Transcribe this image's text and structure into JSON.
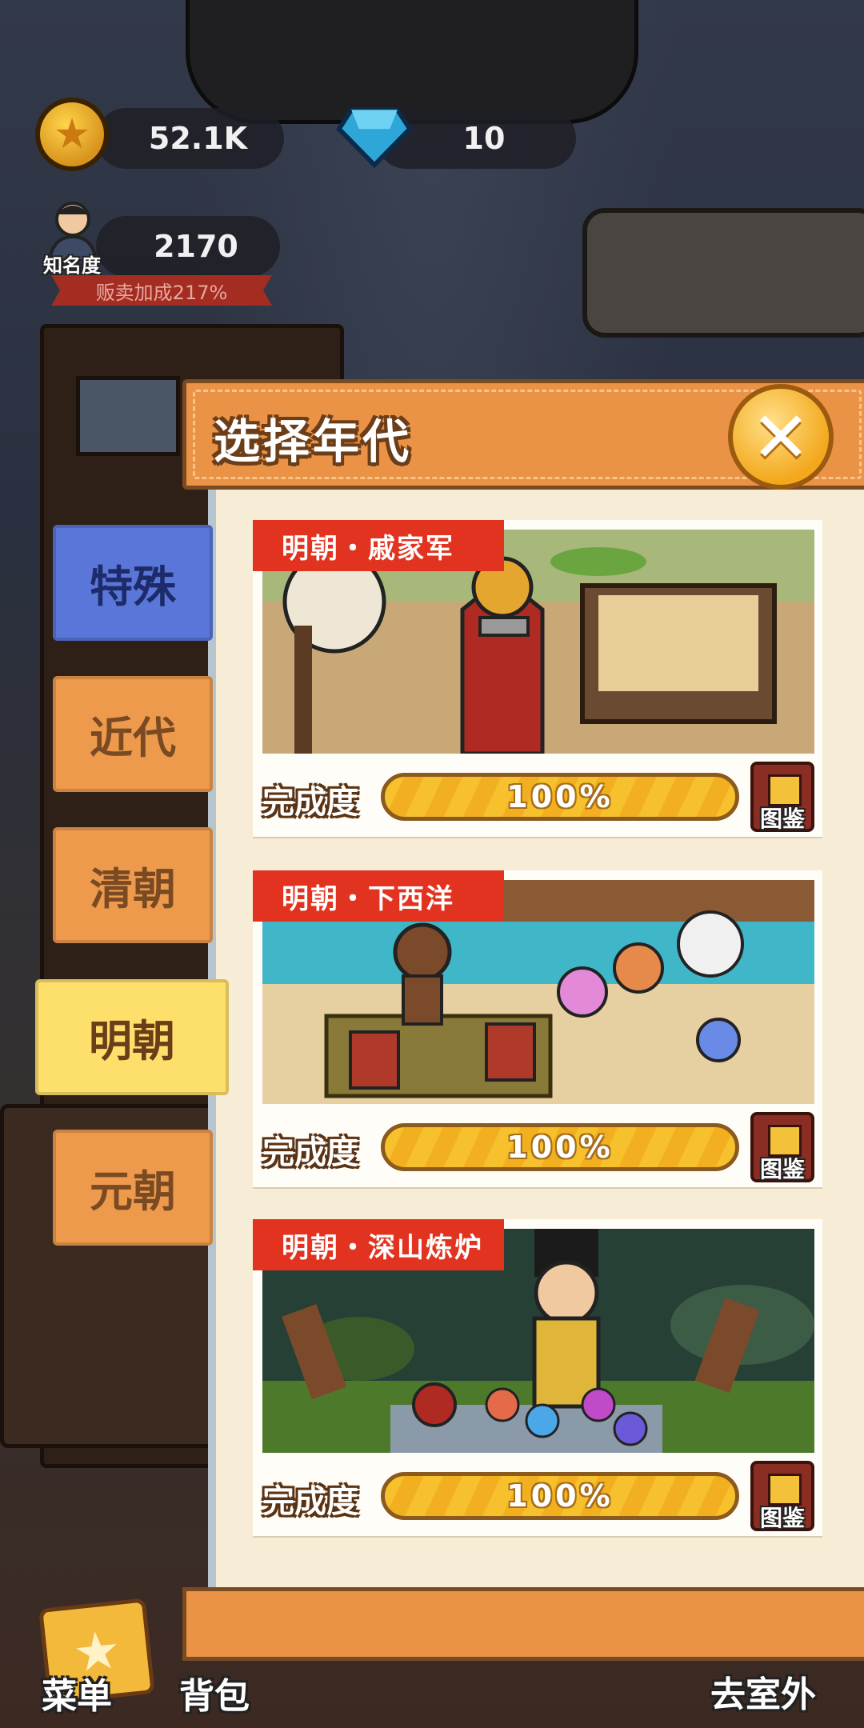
{
  "hud": {
    "coins": "52.1K",
    "gems": "10",
    "fame_value": "2170",
    "fame_label": "知名度",
    "bonus_text": "贩卖加成217%"
  },
  "panel": {
    "title": "选择年代"
  },
  "tabs": [
    {
      "label": "特殊",
      "state": "blue"
    },
    {
      "label": "近代",
      "state": "normal"
    },
    {
      "label": "清朝",
      "state": "normal"
    },
    {
      "label": "明朝",
      "state": "selected"
    },
    {
      "label": "元朝",
      "state": "normal"
    }
  ],
  "cards": [
    {
      "tag": "明朝・戚家军",
      "completion_label": "完成度",
      "progress": 1.0,
      "progress_text": "100%",
      "book_label": "图鉴"
    },
    {
      "tag": "明朝・下西洋",
      "completion_label": "完成度",
      "progress": 1.0,
      "progress_text": "100%",
      "book_label": "图鉴"
    },
    {
      "tag": "明朝・深山炼炉",
      "completion_label": "完成度",
      "progress": 1.0,
      "progress_text": "100%",
      "book_label": "图鉴"
    }
  ],
  "bottom_nav": {
    "menu": "菜单",
    "bag": "背包",
    "outside": "去室外"
  },
  "colors": {
    "accent_orange": "#ea9245",
    "tag_red": "#e1331f",
    "selected_tab": "#fddf6c",
    "special_tab": "#5a76d8",
    "progress_yellow": "#f6c12c"
  }
}
